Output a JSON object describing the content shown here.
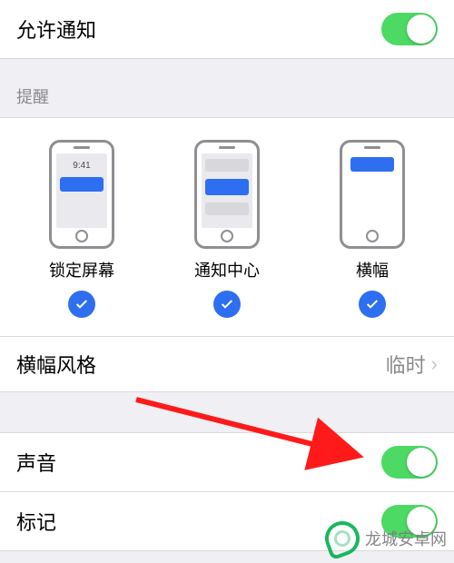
{
  "allow_notifications": {
    "label": "允许通知",
    "on": true
  },
  "alerts_header": "提醒",
  "previews": {
    "lock": {
      "label": "锁定屏幕",
      "time": "9:41",
      "checked": true
    },
    "center": {
      "label": "通知中心",
      "checked": true
    },
    "banner": {
      "label": "横幅",
      "checked": true
    }
  },
  "banner_style": {
    "label": "横幅风格",
    "value": "临时"
  },
  "sounds": {
    "label": "声音",
    "on": true
  },
  "badges": {
    "label": "标记",
    "on": true
  },
  "watermark": "龙城安卓网"
}
